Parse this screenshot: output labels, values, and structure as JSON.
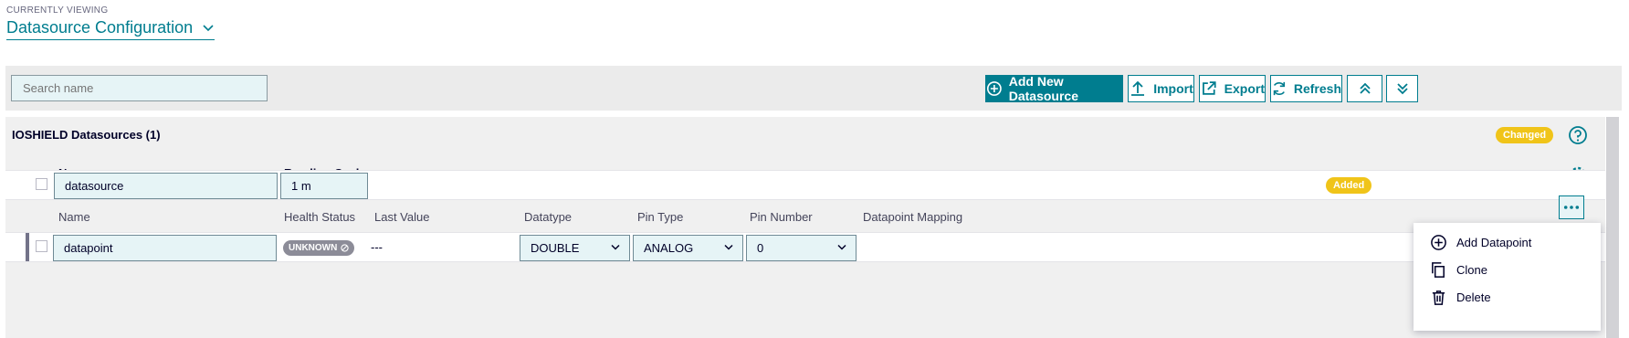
{
  "header": {
    "viewing_label": "CURRENTLY VIEWING",
    "title": "Datasource Configuration"
  },
  "toolbar": {
    "search_placeholder": "Search name",
    "add_label": "Add New Datasource",
    "import_label": "Import",
    "export_label": "Export",
    "refresh_label": "Refresh"
  },
  "panel": {
    "title": "IOSHIELD Datasources (1)",
    "changed_badge": "Changed",
    "columns": {
      "name": "Name",
      "reading_cycle": "Reading Cycle"
    },
    "datasource_row": {
      "name": "datasource",
      "reading_cycle": "1 m",
      "badge": "Added"
    },
    "datapoint_columns": {
      "name": "Name",
      "health": "Health Status",
      "last_value": "Last Value",
      "datatype": "Datatype",
      "pin_type": "Pin Type",
      "pin_number": "Pin Number",
      "mapping": "Datapoint Mapping"
    },
    "datapoint_row": {
      "name": "datapoint",
      "health": "UNKNOWN",
      "last_value": "---",
      "datatype": "DOUBLE",
      "pin_type": "ANALOG",
      "pin_number": "0"
    }
  },
  "context_menu": {
    "add": "Add Datapoint",
    "clone": "Clone",
    "delete": "Delete"
  },
  "colors": {
    "accent": "#007d8f",
    "badge": "#f0c419",
    "field_bg": "#e6f4f6"
  }
}
